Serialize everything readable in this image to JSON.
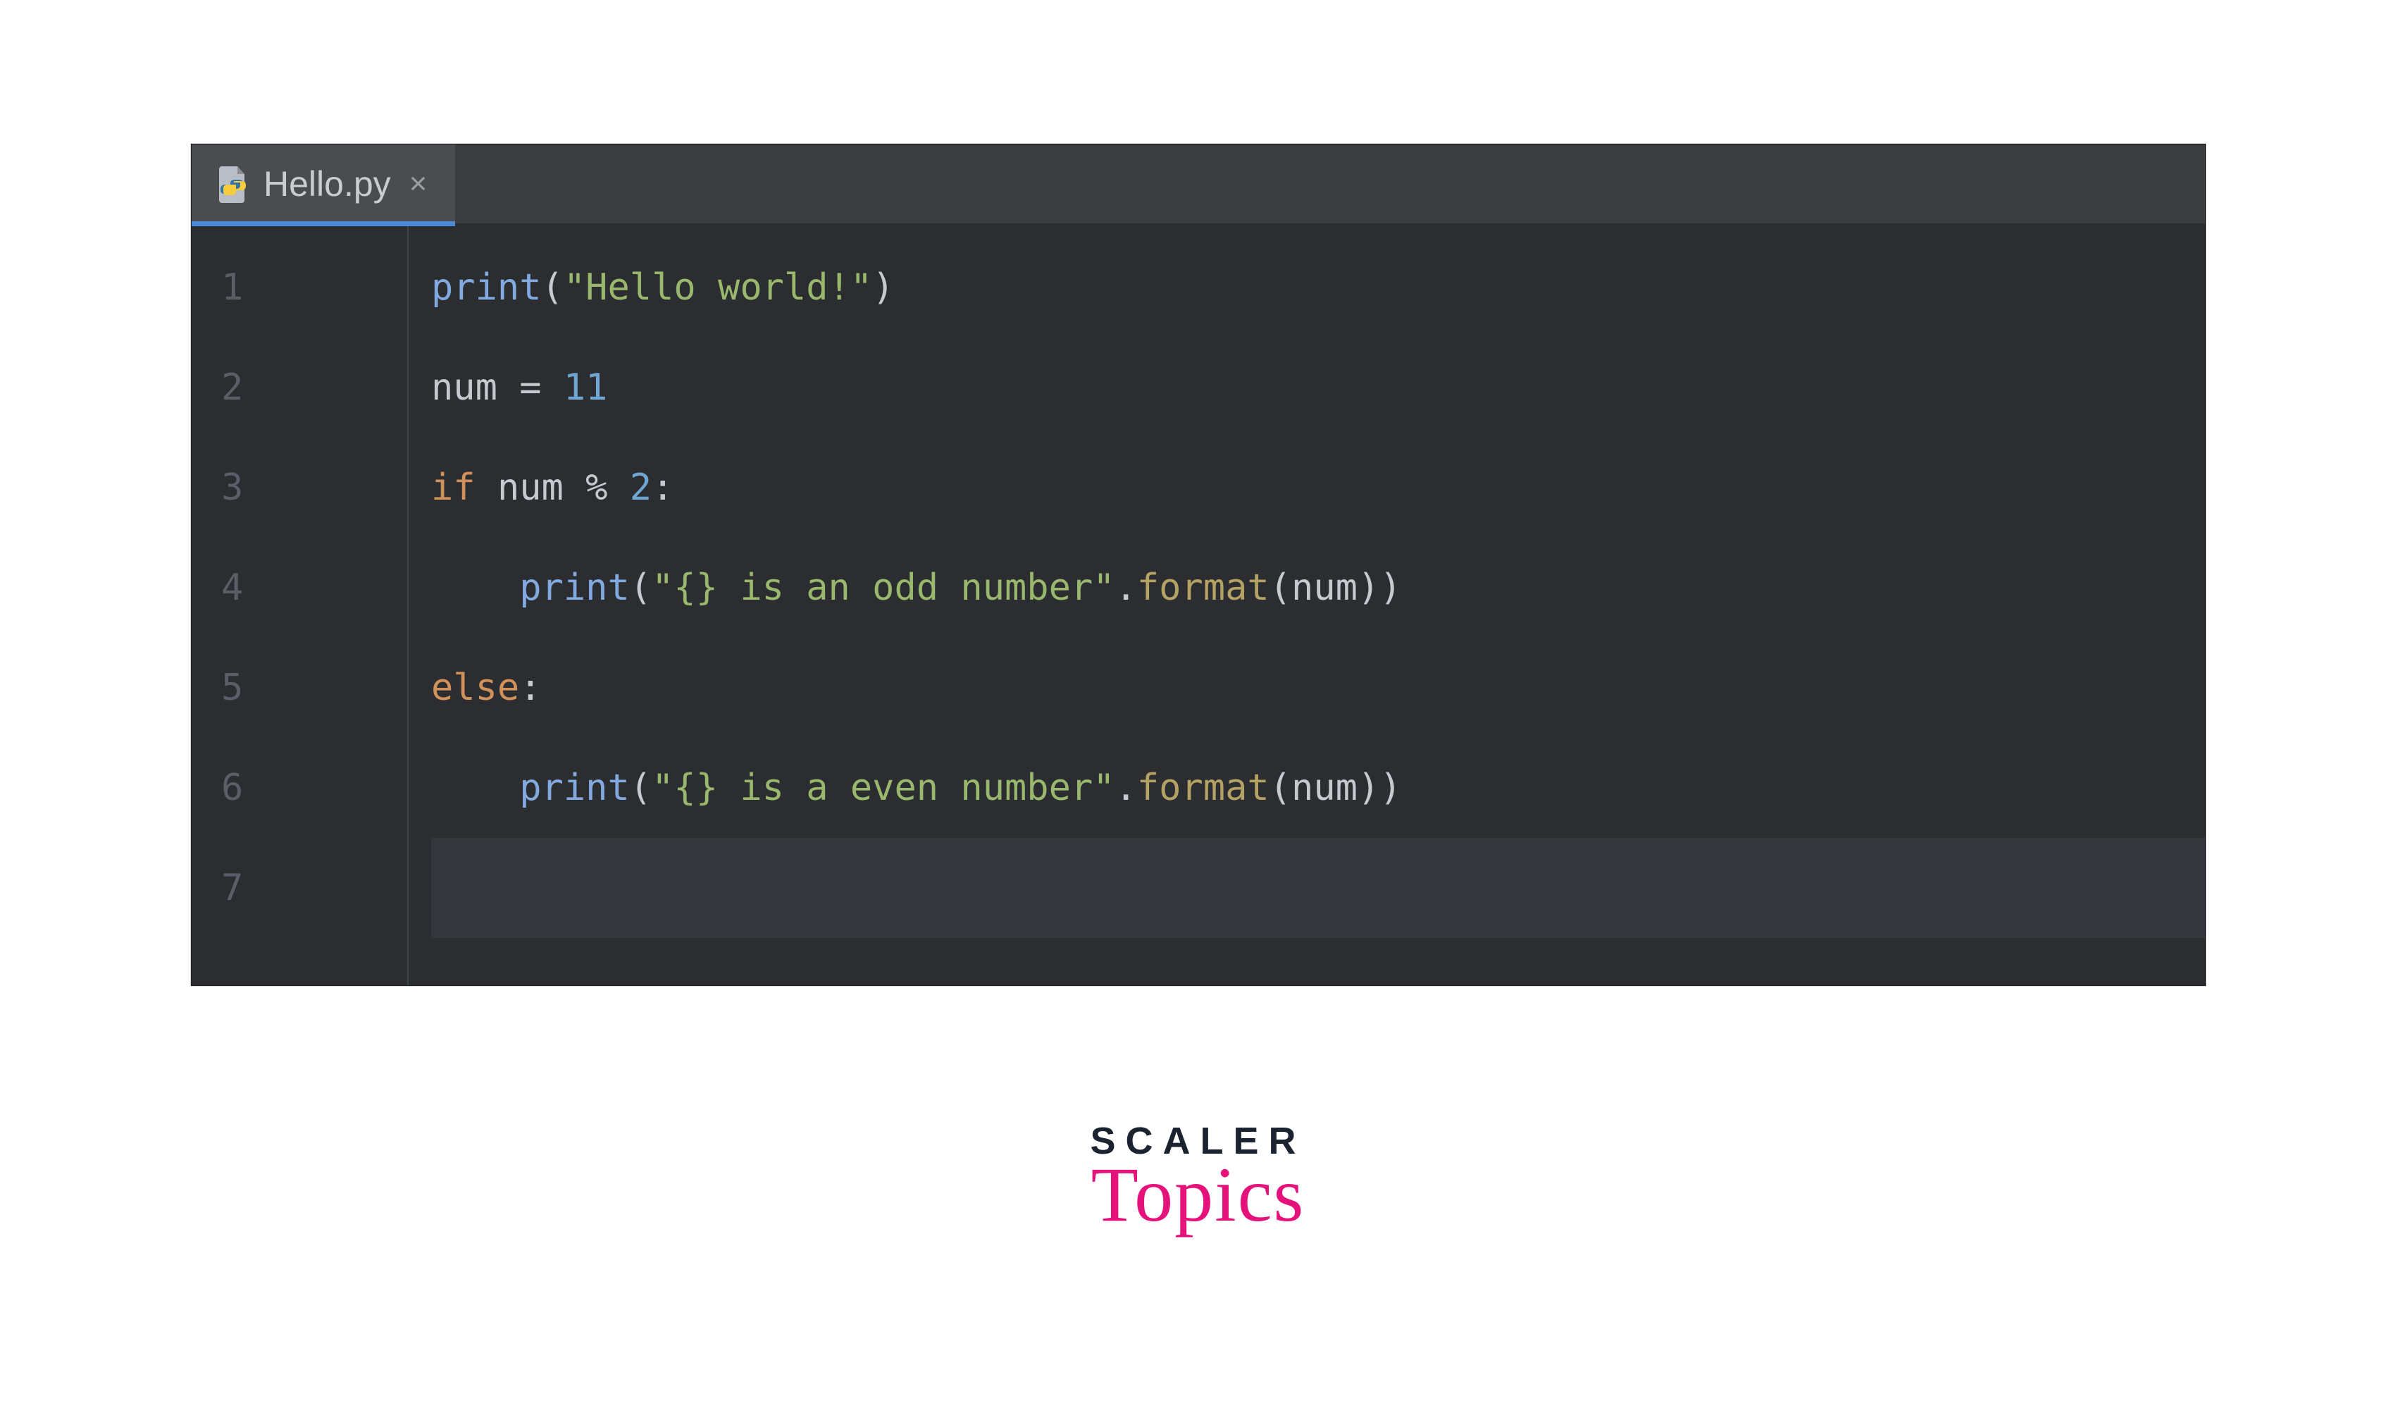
{
  "editor": {
    "tab": {
      "icon": "python-file-icon",
      "label": "Hello.py",
      "close": "×",
      "active": true
    },
    "gutter_start": 1,
    "gutter_count": 7,
    "code": {
      "line1": {
        "fn": "print",
        "p1": "(",
        "str": "\"Hello world!\"",
        "p2": ")"
      },
      "line2": {
        "ident": "num",
        "sp1": " ",
        "op": "=",
        "sp2": " ",
        "num": "11"
      },
      "line3": {
        "kw": "if",
        "sp1": " ",
        "ident": "num",
        "sp2": " ",
        "op": "%",
        "sp3": " ",
        "num": "2",
        "colon": ":"
      },
      "line4": {
        "indent": "    ",
        "fn": "print",
        "p1": "(",
        "str": "\"{} is an odd number\"",
        "dot": ".",
        "method": "format",
        "p2": "(",
        "arg": "num",
        "p3": ")",
        ")": "",
        ")2": ")"
      },
      "line5": {
        "kw": "else",
        "colon": ":"
      },
      "line6": {
        "indent": "    ",
        "fn": "print",
        "p1": "(",
        "str": "\"{} is a even number\"",
        "dot": ".",
        "method": "format",
        "p2": "(",
        "arg": "num",
        "p3": ")",
        ")2": ")"
      }
    }
  },
  "logo": {
    "top": "SCALER",
    "bottom": "Topics"
  }
}
